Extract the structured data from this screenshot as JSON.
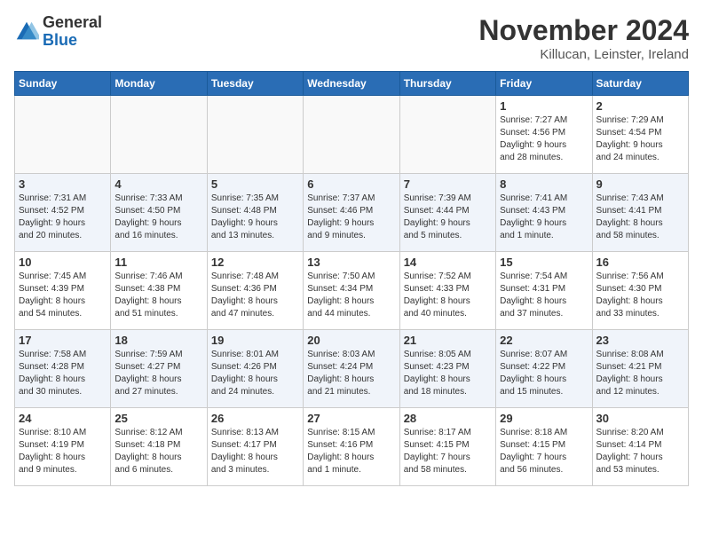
{
  "header": {
    "logo_general": "General",
    "logo_blue": "Blue",
    "month_title": "November 2024",
    "location": "Killucan, Leinster, Ireland"
  },
  "days_of_week": [
    "Sunday",
    "Monday",
    "Tuesday",
    "Wednesday",
    "Thursday",
    "Friday",
    "Saturday"
  ],
  "weeks": [
    [
      {
        "day": "",
        "info": ""
      },
      {
        "day": "",
        "info": ""
      },
      {
        "day": "",
        "info": ""
      },
      {
        "day": "",
        "info": ""
      },
      {
        "day": "",
        "info": ""
      },
      {
        "day": "1",
        "info": "Sunrise: 7:27 AM\nSunset: 4:56 PM\nDaylight: 9 hours\nand 28 minutes."
      },
      {
        "day": "2",
        "info": "Sunrise: 7:29 AM\nSunset: 4:54 PM\nDaylight: 9 hours\nand 24 minutes."
      }
    ],
    [
      {
        "day": "3",
        "info": "Sunrise: 7:31 AM\nSunset: 4:52 PM\nDaylight: 9 hours\nand 20 minutes."
      },
      {
        "day": "4",
        "info": "Sunrise: 7:33 AM\nSunset: 4:50 PM\nDaylight: 9 hours\nand 16 minutes."
      },
      {
        "day": "5",
        "info": "Sunrise: 7:35 AM\nSunset: 4:48 PM\nDaylight: 9 hours\nand 13 minutes."
      },
      {
        "day": "6",
        "info": "Sunrise: 7:37 AM\nSunset: 4:46 PM\nDaylight: 9 hours\nand 9 minutes."
      },
      {
        "day": "7",
        "info": "Sunrise: 7:39 AM\nSunset: 4:44 PM\nDaylight: 9 hours\nand 5 minutes."
      },
      {
        "day": "8",
        "info": "Sunrise: 7:41 AM\nSunset: 4:43 PM\nDaylight: 9 hours\nand 1 minute."
      },
      {
        "day": "9",
        "info": "Sunrise: 7:43 AM\nSunset: 4:41 PM\nDaylight: 8 hours\nand 58 minutes."
      }
    ],
    [
      {
        "day": "10",
        "info": "Sunrise: 7:45 AM\nSunset: 4:39 PM\nDaylight: 8 hours\nand 54 minutes."
      },
      {
        "day": "11",
        "info": "Sunrise: 7:46 AM\nSunset: 4:38 PM\nDaylight: 8 hours\nand 51 minutes."
      },
      {
        "day": "12",
        "info": "Sunrise: 7:48 AM\nSunset: 4:36 PM\nDaylight: 8 hours\nand 47 minutes."
      },
      {
        "day": "13",
        "info": "Sunrise: 7:50 AM\nSunset: 4:34 PM\nDaylight: 8 hours\nand 44 minutes."
      },
      {
        "day": "14",
        "info": "Sunrise: 7:52 AM\nSunset: 4:33 PM\nDaylight: 8 hours\nand 40 minutes."
      },
      {
        "day": "15",
        "info": "Sunrise: 7:54 AM\nSunset: 4:31 PM\nDaylight: 8 hours\nand 37 minutes."
      },
      {
        "day": "16",
        "info": "Sunrise: 7:56 AM\nSunset: 4:30 PM\nDaylight: 8 hours\nand 33 minutes."
      }
    ],
    [
      {
        "day": "17",
        "info": "Sunrise: 7:58 AM\nSunset: 4:28 PM\nDaylight: 8 hours\nand 30 minutes."
      },
      {
        "day": "18",
        "info": "Sunrise: 7:59 AM\nSunset: 4:27 PM\nDaylight: 8 hours\nand 27 minutes."
      },
      {
        "day": "19",
        "info": "Sunrise: 8:01 AM\nSunset: 4:26 PM\nDaylight: 8 hours\nand 24 minutes."
      },
      {
        "day": "20",
        "info": "Sunrise: 8:03 AM\nSunset: 4:24 PM\nDaylight: 8 hours\nand 21 minutes."
      },
      {
        "day": "21",
        "info": "Sunrise: 8:05 AM\nSunset: 4:23 PM\nDaylight: 8 hours\nand 18 minutes."
      },
      {
        "day": "22",
        "info": "Sunrise: 8:07 AM\nSunset: 4:22 PM\nDaylight: 8 hours\nand 15 minutes."
      },
      {
        "day": "23",
        "info": "Sunrise: 8:08 AM\nSunset: 4:21 PM\nDaylight: 8 hours\nand 12 minutes."
      }
    ],
    [
      {
        "day": "24",
        "info": "Sunrise: 8:10 AM\nSunset: 4:19 PM\nDaylight: 8 hours\nand 9 minutes."
      },
      {
        "day": "25",
        "info": "Sunrise: 8:12 AM\nSunset: 4:18 PM\nDaylight: 8 hours\nand 6 minutes."
      },
      {
        "day": "26",
        "info": "Sunrise: 8:13 AM\nSunset: 4:17 PM\nDaylight: 8 hours\nand 3 minutes."
      },
      {
        "day": "27",
        "info": "Sunrise: 8:15 AM\nSunset: 4:16 PM\nDaylight: 8 hours\nand 1 minute."
      },
      {
        "day": "28",
        "info": "Sunrise: 8:17 AM\nSunset: 4:15 PM\nDaylight: 7 hours\nand 58 minutes."
      },
      {
        "day": "29",
        "info": "Sunrise: 8:18 AM\nSunset: 4:15 PM\nDaylight: 7 hours\nand 56 minutes."
      },
      {
        "day": "30",
        "info": "Sunrise: 8:20 AM\nSunset: 4:14 PM\nDaylight: 7 hours\nand 53 minutes."
      }
    ]
  ]
}
